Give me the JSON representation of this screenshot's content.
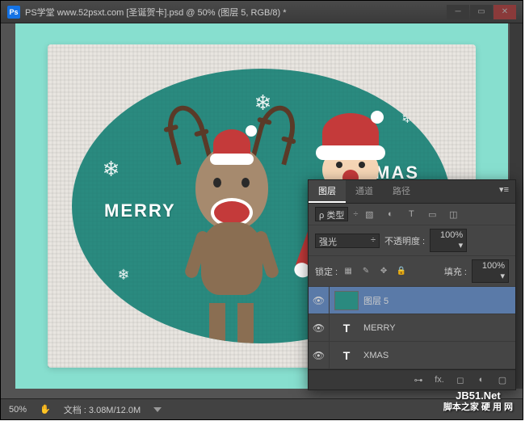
{
  "titlebar": {
    "ps": "Ps",
    "title": "PS学堂  www.52psxt.com [圣诞贺卡].psd @ 50% (图层 5, RGB/8) *"
  },
  "artwork": {
    "merry": "MERRY",
    "xmas": "XMAS"
  },
  "statusbar": {
    "zoom": "50%",
    "doc": "文档 : 3.08M/12.0M"
  },
  "panel": {
    "tabs": {
      "layers": "图层",
      "channels": "通道",
      "paths": "路径"
    },
    "kind_label": "ρ 类型",
    "blend": "强光",
    "opacity_label": "不透明度 :",
    "opacity": "100%",
    "lock_label": "锁定 :",
    "fill_label": "填充 :",
    "fill": "100%",
    "layers": [
      {
        "name": "图层 5",
        "type": "pixel",
        "selected": true
      },
      {
        "name": "MERRY",
        "type": "text",
        "selected": false
      },
      {
        "name": "XMAS",
        "type": "text",
        "selected": false
      }
    ]
  },
  "watermark": {
    "en": "JB51.Net",
    "cn": "脚本之家 硬 用 网"
  }
}
